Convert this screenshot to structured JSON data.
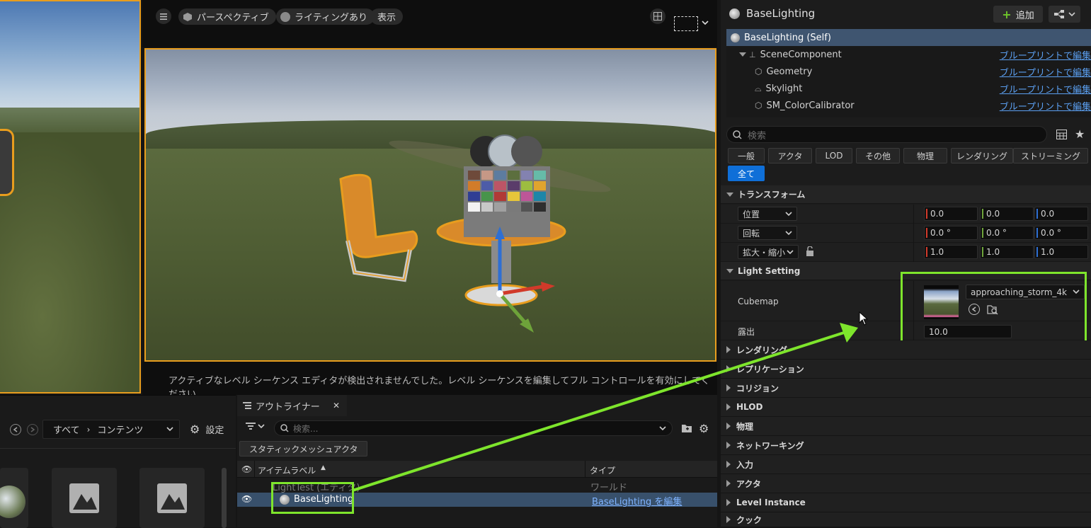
{
  "viewport_toolbar": {
    "perspective_label": "パースペクティブ",
    "lighting_label": "ライティングあり",
    "show_label": "表示"
  },
  "viewport_message": "アクティブなレベル シーケンス エディタが検出されませんでした。レベル シーケンスを編集してフル コントロールを有効にしてください",
  "content_browser": {
    "breadcrumb_all": "すべて",
    "breadcrumb_content": "コンテンツ",
    "settings_label": "設定"
  },
  "outliner": {
    "tab_label": "アウトライナー",
    "search_placeholder": "検索...",
    "filter_chip": "スタティックメッシュアクタ",
    "col_label": "アイテムラベル",
    "col_type": "タイプ",
    "rows": [
      {
        "label": "LightTest (エディタ)",
        "type": "ワールド"
      },
      {
        "label": "BaseLighting",
        "type": "BaseLighting を編集"
      }
    ]
  },
  "details": {
    "title": "BaseLighting",
    "add_label": "追加",
    "components": [
      {
        "label": "BaseLighting (Self)",
        "link": ""
      },
      {
        "label": "SceneComponent",
        "link": "ブループリントで編集"
      },
      {
        "label": "Geometry",
        "link": "ブループリントで編集"
      },
      {
        "label": "Skylight",
        "link": "ブループリントで編集"
      },
      {
        "label": "SM_ColorCalibrator",
        "link": "ブループリントで編集"
      }
    ],
    "search_placeholder": "検索",
    "categories": [
      "一般",
      "アクタ",
      "LOD",
      "その他",
      "物理",
      "レンダリング",
      "ストリーミング",
      "全て"
    ],
    "transform_header": "トランスフォーム",
    "location_label": "位置",
    "rotation_label": "回転",
    "scale_label": "拡大・縮小",
    "location": [
      "0.0",
      "0.0",
      "0.0"
    ],
    "rotation": [
      "0.0 °",
      "0.0 °",
      "0.0 °"
    ],
    "scale": [
      "1.0",
      "1.0",
      "1.0"
    ],
    "light_setting_header": "Light Setting",
    "cubemap_label": "Cubemap",
    "cubemap_value": "approaching_storm_4k",
    "exposure_label": "露出",
    "exposure_value": "10.0",
    "collapsed_sections": [
      "レンダリング",
      "レプリケーション",
      "コリジョン",
      "HLOD",
      "物理",
      "ネットワーキング",
      "入力",
      "アクタ",
      "Level Instance",
      "クック"
    ]
  },
  "colors": {
    "selection_orange": "#e89d1e",
    "highlight_green": "#7ee52c",
    "link_blue": "#5b9ff0",
    "active_blue": "#0f6fd8"
  }
}
